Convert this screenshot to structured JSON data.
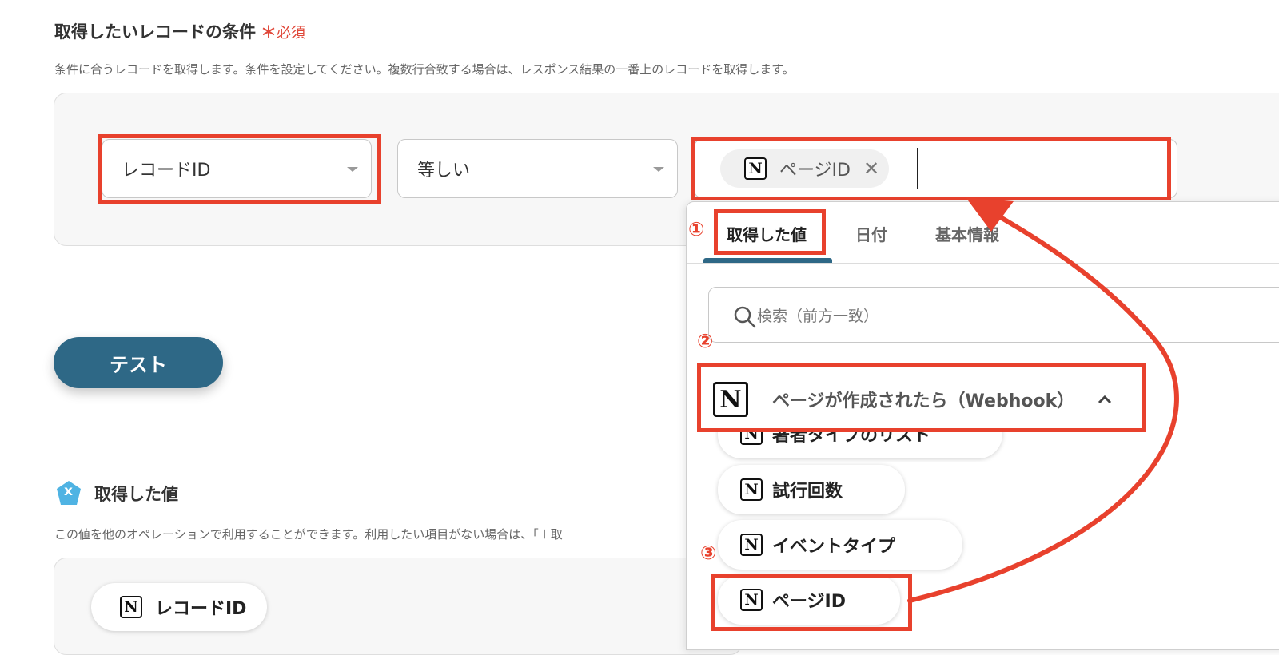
{
  "section": {
    "title": "取得したいレコードの条件",
    "required_mark": "＊",
    "required_label": "必須",
    "description": "条件に合うレコードを取得します。条件を設定してください。複数行合致する場合は、レスポンス結果の一番上のレコードを取得します。"
  },
  "condition": {
    "field_value": "レコードID",
    "operator_value": "等しい",
    "value_chip_label": "ページID"
  },
  "test_button": {
    "label": "テスト"
  },
  "output": {
    "title": "取得した値",
    "icon_glyph": "x",
    "description": "この値を他のオペレーションで利用することができます。利用したい項目がない場合は、「＋取",
    "chip_label": "レコードID"
  },
  "dropdown": {
    "tabs": [
      {
        "label": "取得した値"
      },
      {
        "label": "日付"
      },
      {
        "label": "基本情報"
      }
    ],
    "search_placeholder": "検索（前方一致）",
    "group_label": "ページが作成されたら（Webhook）",
    "items": [
      {
        "label": "著者タイプのリスト"
      },
      {
        "label": "試行回数"
      },
      {
        "label": "イベントタイプ"
      },
      {
        "label": "ページID"
      }
    ]
  },
  "annotations": {
    "step1": "①",
    "step2": "②",
    "step3": "③"
  },
  "icons": {
    "notion_glyph": "N",
    "clear_glyph": "✕"
  },
  "colors": {
    "accent": "#2e6886",
    "annotation_red": "#e8412d",
    "required_red": "#e0483a"
  }
}
